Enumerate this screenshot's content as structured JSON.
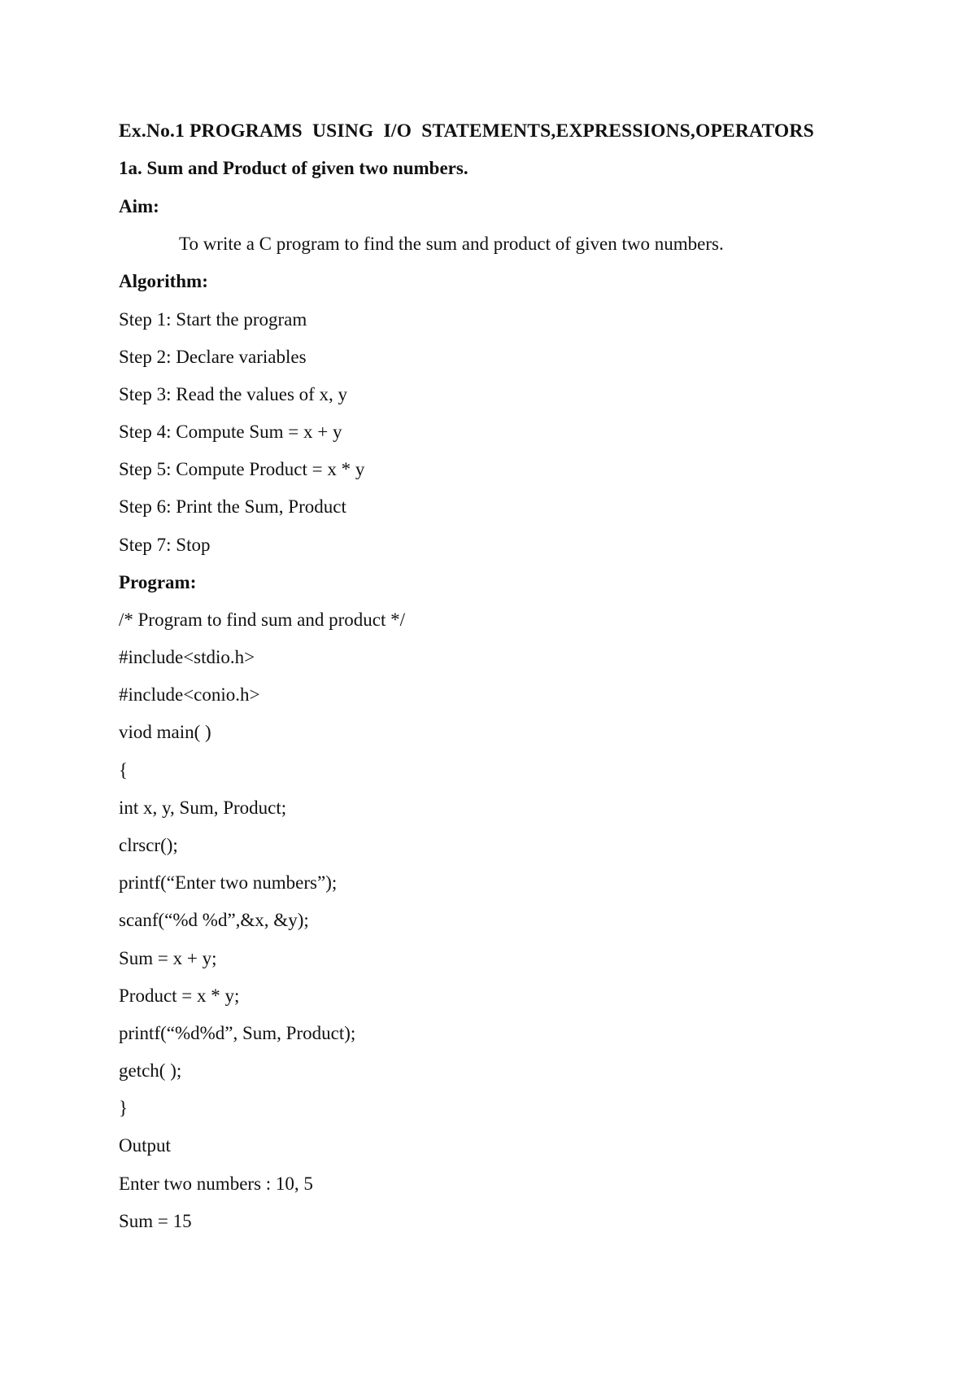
{
  "document": {
    "title": "Ex.No.1 PROGRAMS  USING  I/O  STATEMENTS,EXPRESSIONS,OPERATORS",
    "subtitle": "1a. Sum and Product of given two numbers.",
    "aim_heading": "Aim:",
    "aim_text": "To write a C program to find the sum and product of given two numbers.",
    "algorithm_heading": "Algorithm:",
    "algorithm_steps": [
      "Step 1: Start the program",
      "Step 2: Declare variables",
      "Step 3: Read the values of x, y",
      "Step 4: Compute Sum = x + y",
      "Step 5: Compute Product = x * y",
      "Step 6: Print the Sum, Product",
      "Step 7: Stop"
    ],
    "program_heading": "Program:",
    "program_lines": [
      "/* Program to find sum and product */",
      "#include<stdio.h>",
      "#include<conio.h>",
      "viod main( )",
      "{",
      "int x, y, Sum, Product;",
      "clrscr();",
      "printf(“Enter two numbers”);",
      "scanf(“%d %d”,&x, &y);",
      "Sum = x + y;",
      "Product = x * y;",
      "printf(“%d%d”, Sum, Product);",
      "getch( );",
      "}"
    ],
    "output_heading": "Output",
    "output_lines": [
      "Enter two numbers : 10, 5",
      "Sum = 15"
    ]
  }
}
